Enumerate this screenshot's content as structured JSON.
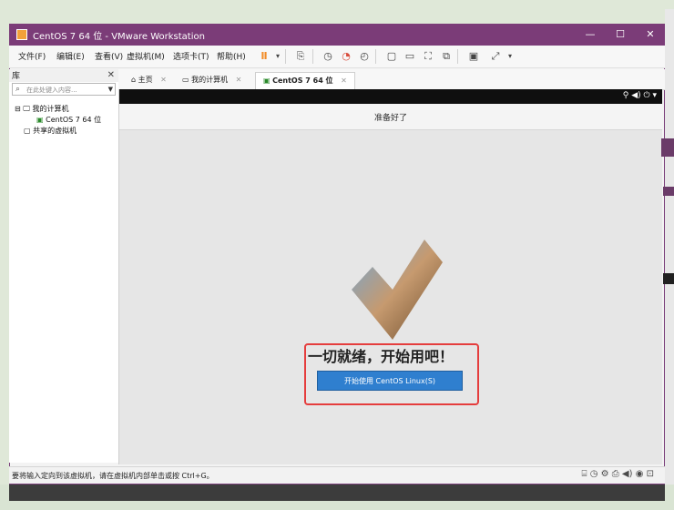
{
  "window": {
    "title": "CentOS 7 64 位 - VMware Workstation",
    "controls": [
      "—",
      "☐",
      "✕"
    ]
  },
  "menu": [
    "文件(F)",
    "编辑(E)",
    "查看(V)",
    "虚拟机(M)",
    "选项卡(T)",
    "帮助(H)"
  ],
  "library": {
    "title": "库",
    "search_placeholder": "在此处键入内容...",
    "tree": [
      "我的计算机",
      "CentOS 7 64 位",
      "共享的虚拟机"
    ]
  },
  "tabs": [
    {
      "label": "主页",
      "active": false
    },
    {
      "label": "我的计算机",
      "active": false
    },
    {
      "label": "CentOS 7 64 位",
      "active": true
    }
  ],
  "vm": {
    "header_title": "准备好了",
    "ready_text": "一切就绪，开始用吧！",
    "start_button": "开始使用 CentOS Linux(S)"
  },
  "status": {
    "text": "要将输入定向到该虚拟机，请在虚拟机内部单击或按 Ctrl+G。"
  },
  "colors": {
    "titlebar": "#7b3c78",
    "button": "#2f7fcf",
    "highlight": "#e53d3d"
  }
}
